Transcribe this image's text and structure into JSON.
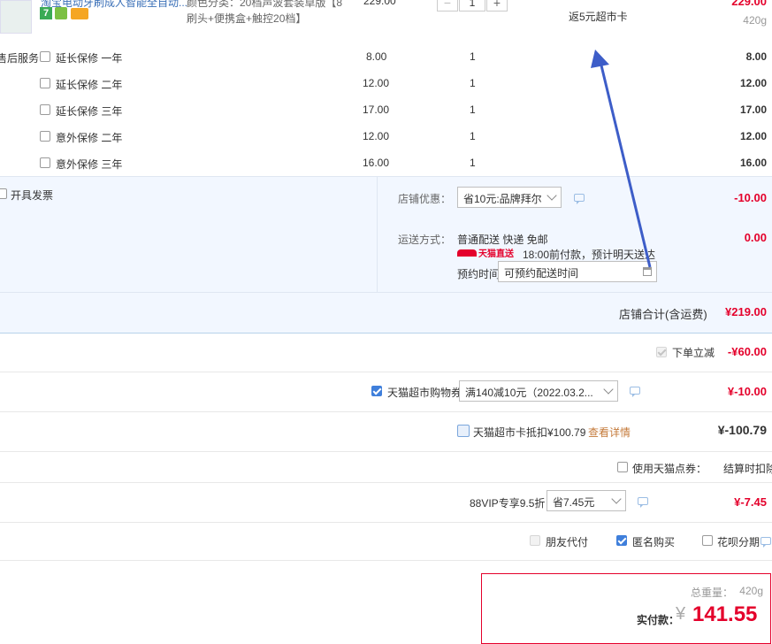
{
  "product": {
    "title_line1": "淘宝电动牙刷成人智能全自动...",
    "spec_line1": "颜色分类：20档声波套装卓版【8",
    "spec_line2": "刷头+便携盒+触控20档】",
    "unit_price_partial": "229.00",
    "quantity": "1",
    "promo": "返5元超市卡",
    "total": "229.00",
    "weight": "420g",
    "badge_num": "7"
  },
  "after_sales": {
    "label": "售后服务",
    "options": [
      {
        "name": "延长保修 一年",
        "price": "8.00",
        "qty": "1",
        "total": "8.00"
      },
      {
        "name": "延长保修 二年",
        "price": "12.00",
        "qty": "1",
        "total": "12.00"
      },
      {
        "name": "延长保修 三年",
        "price": "17.00",
        "qty": "1",
        "total": "17.00"
      },
      {
        "name": "意外保修 二年",
        "price": "12.00",
        "qty": "1",
        "total": "12.00"
      },
      {
        "name": "意外保修 三年",
        "price": "16.00",
        "qty": "1",
        "total": "16.00"
      }
    ]
  },
  "invoice": {
    "label": "开具发票"
  },
  "store_discount": {
    "label": "店铺优惠：",
    "selected": "省10元:品牌拜尔",
    "amount": "-10.00"
  },
  "shipping": {
    "label": "运送方式：",
    "methods": "普通配送 快递 免邮",
    "tmall_logo": "天猫直送",
    "eta": "18:00前付款，预计明天送达",
    "appt_label": "预约时间",
    "appt_placeholder": "可预约配送时间",
    "amount": "0.00"
  },
  "store_total": {
    "label": "店铺合计(含运费)",
    "amount": "¥219.00"
  },
  "instant_discount": {
    "label": "下单立减",
    "amount": "-¥60.00"
  },
  "coupon": {
    "label": "天猫超市购物券",
    "selected": "满140减10元（2022.03.2...",
    "amount": "¥-10.00"
  },
  "card": {
    "label": "天猫超市卡抵扣¥100.79",
    "link": "查看详情",
    "amount": "¥-100.79"
  },
  "points": {
    "label": "使用天猫点券：",
    "value": "结算时扣除"
  },
  "vip": {
    "label": "88VIP专享9.5折",
    "selected": "省7.45元",
    "amount": "¥-7.45"
  },
  "options": {
    "friend_pay": "朋友代付",
    "anonymous": "匿名购买",
    "huabei": "花呗分期"
  },
  "summary": {
    "weight_label": "总重量：",
    "weight": "420g",
    "pay_label": "实付款：",
    "currency": "¥",
    "amount": "141.55"
  },
  "colors": {
    "accent_red": "#e4002b",
    "blue_check": "#3f7fdb",
    "section_bg": "#f2f7ff",
    "arrow": "#3d5dc8"
  }
}
